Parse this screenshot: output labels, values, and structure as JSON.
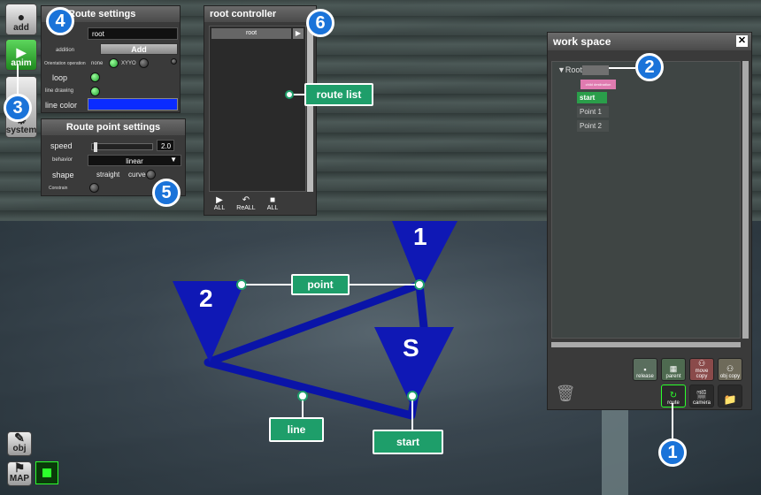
{
  "left_toolbar": {
    "add_label": "add",
    "anim_label": "anim",
    "system_label": "system",
    "obj_label": "obj",
    "map_label": "MAP"
  },
  "route_settings": {
    "title": "Route settings",
    "name_value": "root",
    "addition_label": "addition",
    "add_button": "Add",
    "orientation_label": "Orientation operation",
    "orientation_none": "none",
    "orientation_xyyo": "XYYO",
    "loop_label": "loop",
    "line_drawing_label": "line drawing",
    "line_color_label": "line color",
    "line_color": "#0a2bff"
  },
  "route_point_settings": {
    "title": "Route point settings",
    "speed_label": "speed",
    "speed_value": "2.0",
    "speed_fraction": 0.03,
    "behavior_label": "behavior",
    "behavior_value": "linear",
    "shape_label": "shape",
    "shape_straight": "straight",
    "shape_curve": "curve",
    "constrain_label": "Constrain"
  },
  "root_controller": {
    "title": "root controller",
    "list_item": "root",
    "play_all_label": "ALL",
    "reall_label": "ReALL",
    "stop_all_label": "ALL"
  },
  "work_space": {
    "title": "work space",
    "root_label": "▼Root",
    "child_destination": "child destination",
    "start_label": "start",
    "point1_label": "Point 1",
    "point2_label": "Point 2",
    "release_label": "release",
    "parent_label": "parent",
    "move_copy_label": "move copy",
    "obj_copy_label": "obj copy",
    "route_label": "route",
    "camera_label": "camera"
  },
  "callouts": {
    "route_list": "route list",
    "point": "point",
    "line": "line",
    "start": "start"
  },
  "badges": [
    "1",
    "2",
    "3",
    "4",
    "5",
    "6"
  ],
  "markers": {
    "point1": "1",
    "point2": "2",
    "start": "S"
  },
  "colors": {
    "route_line": "#0a14a8",
    "callout_bg": "#1e9e6a",
    "badge_bg": "#1a73d9"
  }
}
